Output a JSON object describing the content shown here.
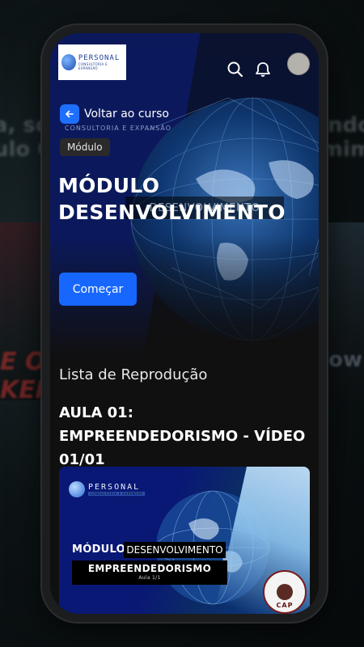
{
  "background": {
    "left_text": "a, sou\nulo Co",
    "right_text": "ando\nmim",
    "left_lower_text": "E OF\nKER",
    "right_lower_text": "ow"
  },
  "header": {
    "logo_name": "PERSONAL",
    "logo_tagline": "CONSULTORIA E EXPANSÃO",
    "search_icon": "search-icon",
    "bell_icon": "bell-icon"
  },
  "hero": {
    "back_label": "Voltar ao curso",
    "faded_subtitle": "CONSULTORIA E EXPANSÃO",
    "badge": "Módulo",
    "title": "MÓDULO DESENVOLVIMENTO",
    "ghost_banner": "DESENVOLVIMENTO",
    "start_label": "Começar"
  },
  "playlist": {
    "section_title": "Lista de Reprodução",
    "lesson_title": "AULA 01: EMPREENDEDORISMO - VÍDEO 01/01",
    "thumbnail": {
      "logo_name": "PERSONAL",
      "logo_tagline": "CONSULTORIA E EXPANSÃO",
      "modulo": "MÓDULO",
      "banner1": "DESENVOLVIMENTO",
      "banner2": "EMPREENDEDORISMO",
      "aula": "Aula 1/1",
      "seal": "CAP"
    }
  },
  "colors": {
    "accent": "#1767ff",
    "background": "#101010",
    "hero_blue": "#0b1a63"
  }
}
